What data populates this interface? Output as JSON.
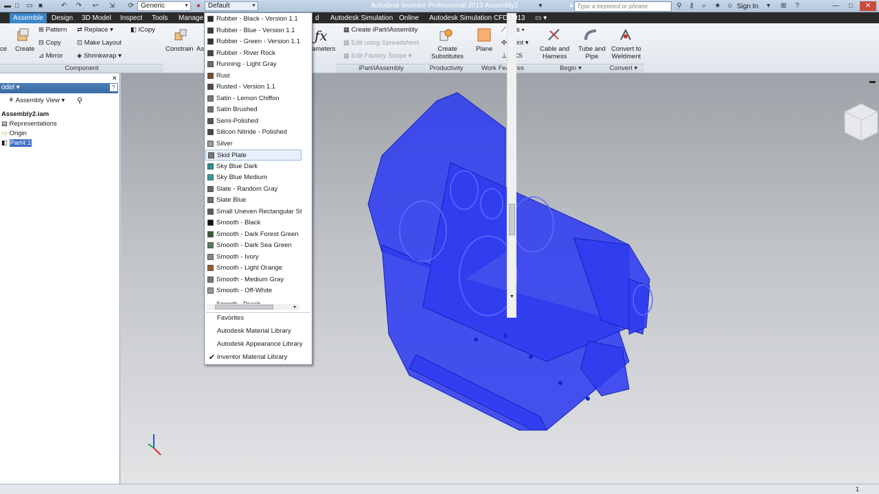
{
  "titlebar": {
    "title": "Autodesk Inventor Professional 2013    Assembly2",
    "style_combo": "Generic",
    "appearance_combo": "Default",
    "search_placeholder": "Type a keyword or phrase",
    "sign_in": "Sign In"
  },
  "tabs": [
    "Assemble",
    "Design",
    "3D Model",
    "Inspect",
    "Tools",
    "Manage",
    "d",
    "Autodesk Simulation",
    "Online",
    "Autodesk Simulation CFD 2013"
  ],
  "ribbon": {
    "component": {
      "create": "Create",
      "pattern": "Pattern",
      "replace": "Replace",
      "icopy": "iCopy",
      "copy": "Copy",
      "make_layout": "Make Layout",
      "mirror": "Mirror",
      "shrinkwrap": "Shrinkwrap",
      "label": "Component"
    },
    "position": {
      "constrain": "Constrain",
      "as": "As"
    },
    "manage": {
      "parameters": "ameters"
    },
    "ipart": {
      "create": "Create iPart/iAssembly",
      "edit_spreadsheet": "Edit using Spreadsheet",
      "edit_scope": "Edit Factory Scope",
      "label": "iPart/iAssembly"
    },
    "productivity": {
      "create_substitutes": "Create\nSubstitutes",
      "label": "Productivity"
    },
    "work": {
      "plane": "Plane",
      "axis": "Axis",
      "point": "Point",
      "ucs": "UCS",
      "label": "Work Features"
    },
    "begin": {
      "cable": "Cable and\nHarness",
      "tube": "Tube and\nPipe",
      "label": "Begin"
    },
    "convert": {
      "weldment": "Convert to\nWeldment",
      "label": "Convert"
    }
  },
  "browser": {
    "header": "odel",
    "view": "Assembly View",
    "items": [
      "Assembly2.iam",
      "Representations",
      "Origin",
      "Part4:1"
    ]
  },
  "materials": [
    {
      "name": "Rubber - Black - Version 1.1",
      "color": "#2a2a2a"
    },
    {
      "name": "Rubber - Blue - Version 1.1",
      "color": "#3a3a3a"
    },
    {
      "name": "Rubber - Green - Version 1.1",
      "color": "#333333"
    },
    {
      "name": "Rubber - River Rock",
      "color": "#444444"
    },
    {
      "name": "Running - Light Gray",
      "color": "#6b6b6b"
    },
    {
      "name": "Rust",
      "color": "#7a4a2a"
    },
    {
      "name": "Rusted - Version 1.1",
      "color": "#5a4a40"
    },
    {
      "name": "Satin - Lemon Chiffon",
      "color": "#777777"
    },
    {
      "name": "Satin Brushed",
      "color": "#707070"
    },
    {
      "name": "Semi-Polished",
      "color": "#555555"
    },
    {
      "name": "Silicon Nitride - Polished",
      "color": "#444444"
    },
    {
      "name": "Silver",
      "color": "#9a9a9a"
    },
    {
      "name": "Skid Plate",
      "color": "#777777"
    },
    {
      "name": "Sky Blue Dark",
      "color": "#2a8f90"
    },
    {
      "name": "Sky Blue Medium",
      "color": "#2aa0a0"
    },
    {
      "name": "Slate - Random Gray",
      "color": "#666666"
    },
    {
      "name": "Slate Blue",
      "color": "#666f7a"
    },
    {
      "name": "Small Uneven Rectangular Sto",
      "color": "#5a5a5a"
    },
    {
      "name": "Smooth - Black",
      "color": "#111111"
    },
    {
      "name": "Smooth - Dark Forest Green",
      "color": "#3a5a3a"
    },
    {
      "name": "Smooth - Dark Sea Green",
      "color": "#557a60"
    },
    {
      "name": "Smooth - Ivory",
      "color": "#888888"
    },
    {
      "name": "Smooth - Light Orange",
      "color": "#a05a20"
    },
    {
      "name": "Smooth - Medium Gray",
      "color": "#777777"
    },
    {
      "name": "Smooth - Off-White",
      "color": "#999999"
    }
  ],
  "libraries": [
    {
      "name": "Favorites",
      "checked": false
    },
    {
      "name": "Autodesk Material Library",
      "checked": false
    },
    {
      "name": "Autodesk Appearance Library",
      "checked": false
    },
    {
      "name": "Inventor Material Library",
      "checked": true
    }
  ],
  "status": {
    "page": "1"
  }
}
